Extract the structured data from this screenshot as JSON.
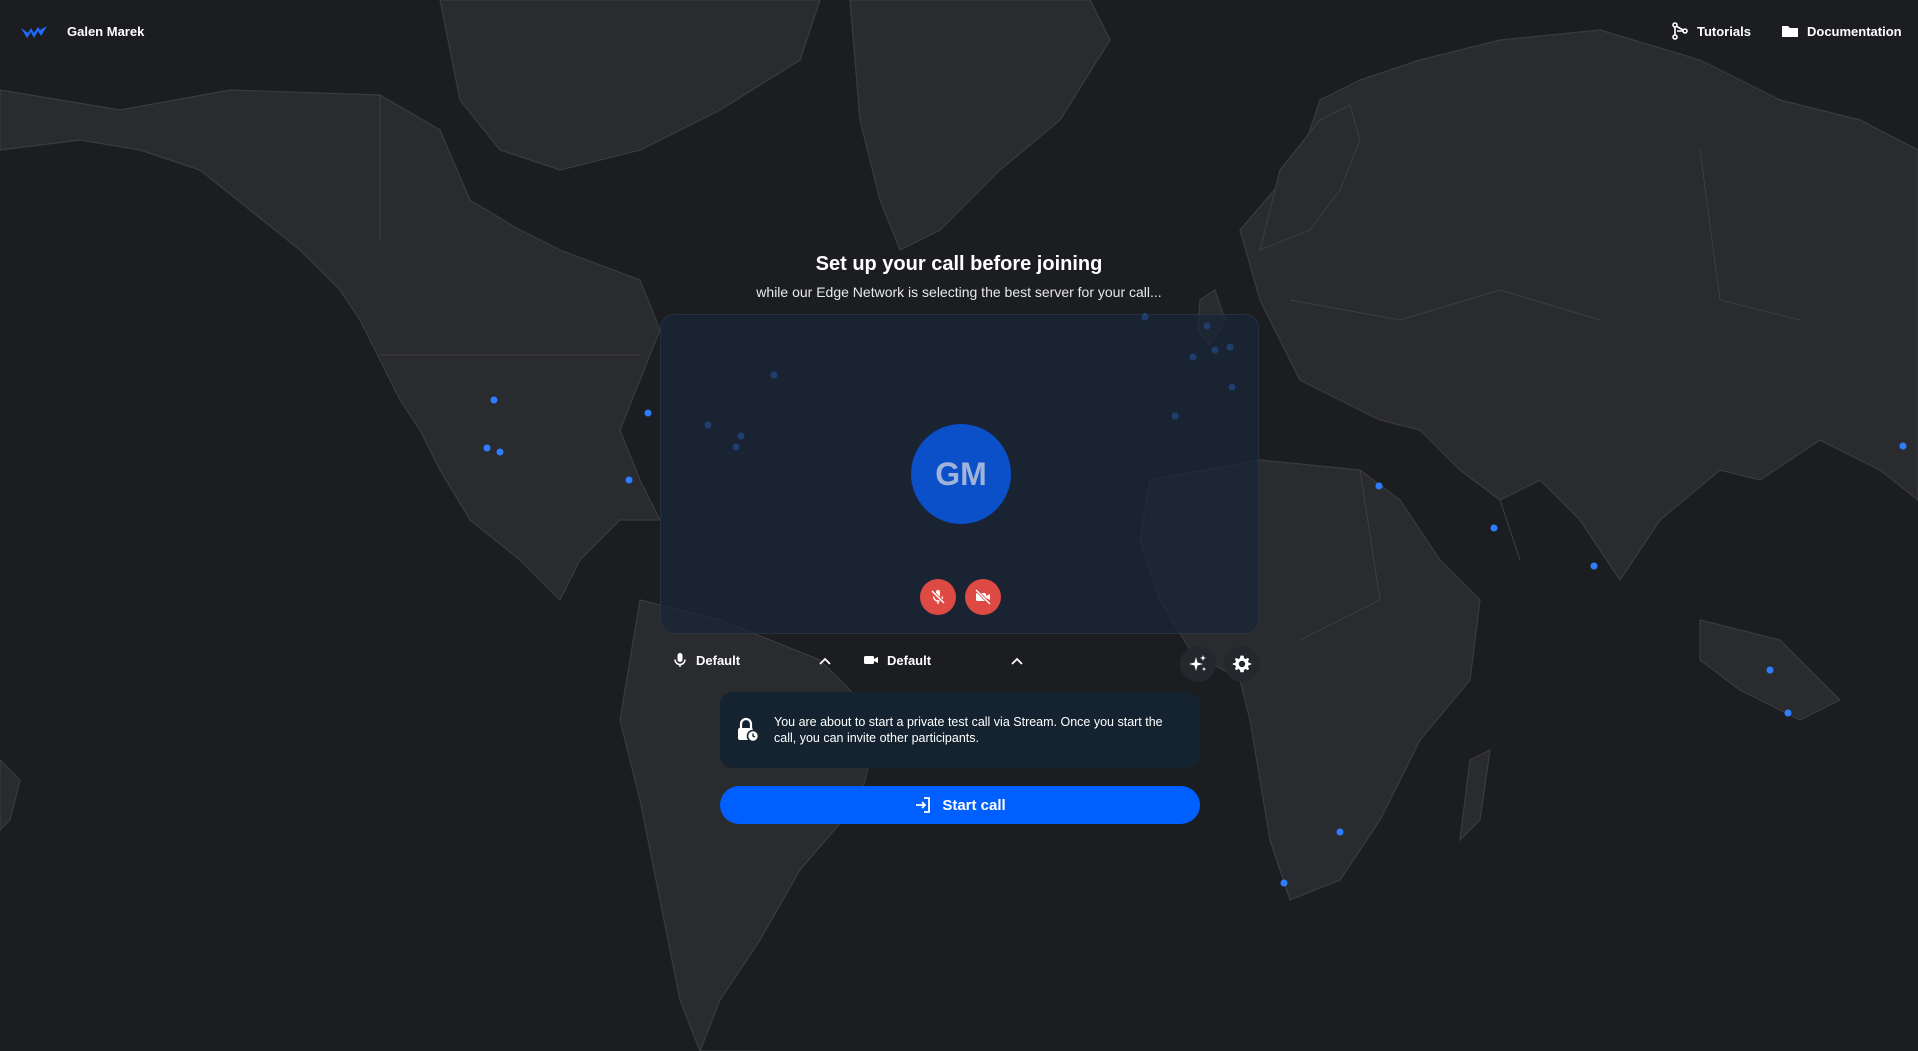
{
  "header": {
    "user_name": "Galen Marek",
    "nav": [
      {
        "label": "Tutorials",
        "icon": "graph-icon"
      },
      {
        "label": "Documentation",
        "icon": "folder-icon"
      }
    ]
  },
  "lobby": {
    "title": "Set up your call before joining",
    "subtitle": "while our Edge Network is selecting the best server for your call...",
    "avatar_initials": "GM",
    "mic_device_label": "Default",
    "camera_device_label": "Default",
    "notice_text": "You are about to start a private test call via Stream. Once you start the call, you can invite other participants.",
    "start_button_label": "Start call"
  },
  "colors": {
    "background": "#1c1d20",
    "accent": "#005fff",
    "avatar": "#0b4fc9",
    "muted_red": "#dd4a43",
    "server_dot": "#2f7dff"
  }
}
